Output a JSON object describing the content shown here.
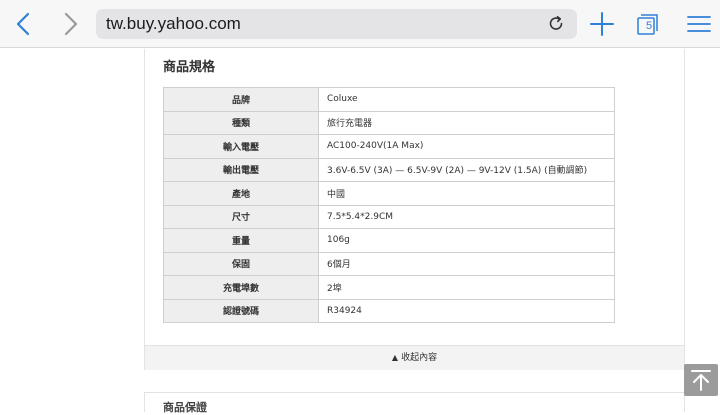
{
  "browser": {
    "url": "tw.buy.yahoo.com",
    "tab_count": "5",
    "accent_color": "#2f80d8"
  },
  "spec_section": {
    "title": "商品規格",
    "rows": [
      {
        "label": "品牌",
        "value": "Coluxe"
      },
      {
        "label": "種類",
        "value": "旅行充電器"
      },
      {
        "label": "輸入電壓",
        "value": "AC100-240V(1A Max)"
      },
      {
        "label": "輸出電壓",
        "value": "3.6V-6.5V (3A) — 6.5V-9V (2A) — 9V-12V (1.5A) (自動調節)"
      },
      {
        "label": "產地",
        "value": "中國"
      },
      {
        "label": "尺寸",
        "value": "7.5*5.4*2.9CM"
      },
      {
        "label": "重量",
        "value": "106g"
      },
      {
        "label": "保固",
        "value": "6個月"
      },
      {
        "label": "充電埠數",
        "value": "2埠"
      },
      {
        "label": "認證號碼",
        "value": "R34924"
      }
    ],
    "collapse_label": "收起內容",
    "collapse_icon": "triangle-up-icon"
  },
  "next_section": {
    "title": "商品保證"
  },
  "icons": {
    "back": "chevron-left-icon",
    "forward": "chevron-right-icon",
    "reload": "reload-icon",
    "new_tab": "plus-icon",
    "tabs": "tabs-icon",
    "menu": "hamburger-menu-icon",
    "scroll_top": "arrow-up-to-top-icon"
  }
}
